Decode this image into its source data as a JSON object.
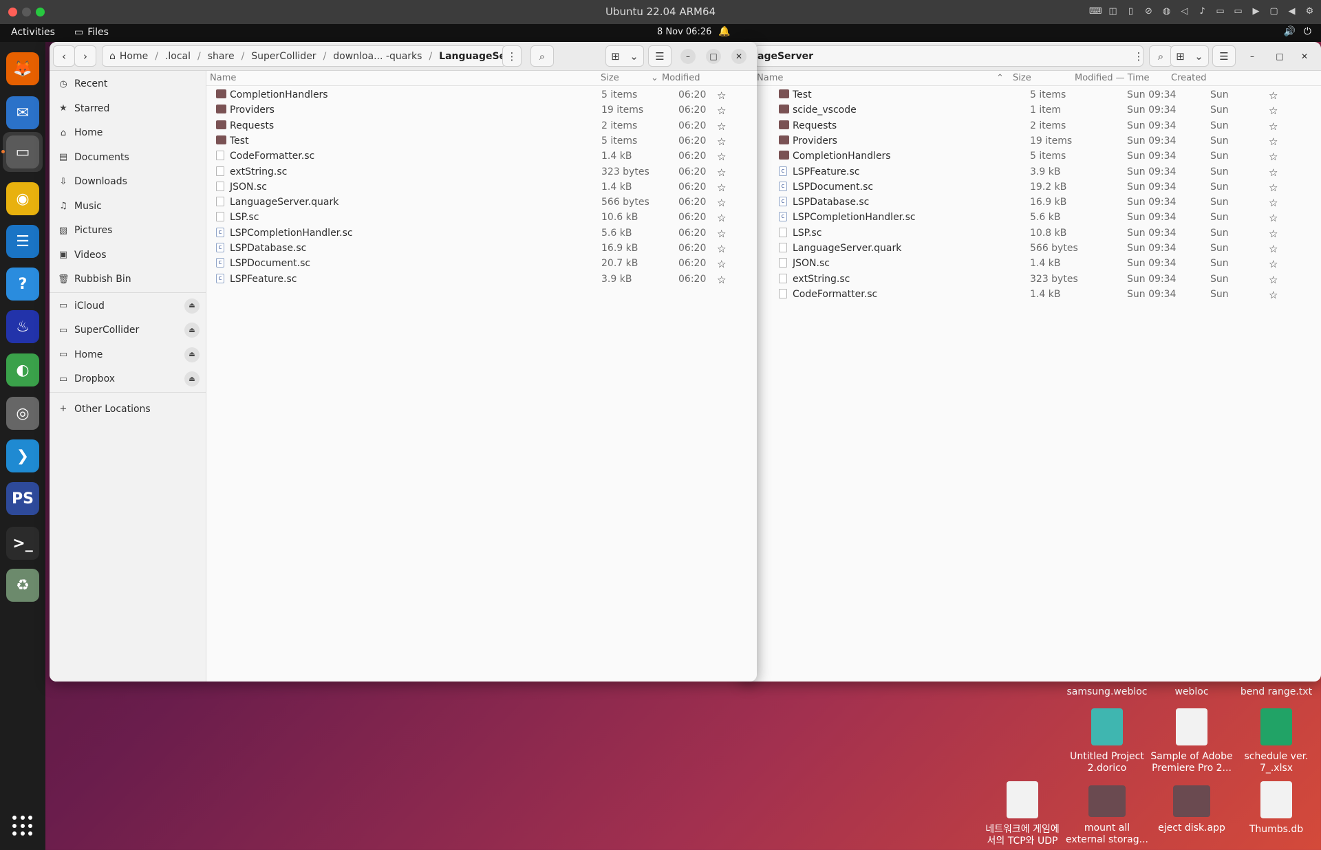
{
  "mac": {
    "title": "Ubuntu 22.04 ARM64",
    "traffic_colors": [
      "#ff5f57",
      "#5a5a5a",
      "#28c840"
    ],
    "status_icons": [
      "keyboard-icon",
      "screenshot-icon",
      "usb-icon",
      "camera-off-icon",
      "globe-icon",
      "speaker-icon",
      "mic-icon",
      "disk-icon",
      "disk2-icon",
      "camera-icon",
      "display-icon",
      "back-icon",
      "gear-icon"
    ]
  },
  "topbar": {
    "activities": "Activities",
    "app_name": "Files",
    "clock": "8 Nov  06:26"
  },
  "dock": {
    "apps": [
      {
        "name": "firefox",
        "glyph": "🦊",
        "color": "#e66000"
      },
      {
        "name": "thunderbird",
        "glyph": "✉",
        "color": "#2b72c9"
      },
      {
        "name": "files",
        "glyph": "▭",
        "color": "#5a5a5a"
      },
      {
        "name": "rhythmbox",
        "glyph": "◉",
        "color": "#e8b10e"
      },
      {
        "name": "writer",
        "glyph": "☰",
        "color": "#1a74c5"
      },
      {
        "name": "help",
        "glyph": "?",
        "color": "#2a8cde"
      },
      {
        "name": "supercollider",
        "glyph": "♨",
        "color": "#2233aa"
      },
      {
        "name": "app-green",
        "glyph": "◐",
        "color": "#3aa14a"
      },
      {
        "name": "app-swirl",
        "glyph": "◎",
        "color": "#666"
      },
      {
        "name": "vscode",
        "glyph": "❯",
        "color": "#1f8ad2"
      },
      {
        "name": "ps",
        "glyph": "PS",
        "color": "#2e4a9a"
      },
      {
        "name": "terminal",
        "glyph": ">_",
        "color": "#2b2b2b"
      },
      {
        "name": "trash",
        "glyph": "♻",
        "color": "#6c8a6c"
      }
    ]
  },
  "left": {
    "path": [
      "Home",
      ".local",
      "share",
      "SuperCollider",
      "downloa... -quarks",
      "LanguageServer"
    ],
    "sidebar": [
      {
        "label": "Recent",
        "icon": "clock-icon",
        "glyph": "◷"
      },
      {
        "label": "Starred",
        "icon": "star-icon",
        "glyph": "★"
      },
      {
        "label": "Home",
        "icon": "home-icon",
        "glyph": "⌂"
      },
      {
        "label": "Documents",
        "icon": "document-icon",
        "glyph": "▤"
      },
      {
        "label": "Downloads",
        "icon": "download-icon",
        "glyph": "⇩"
      },
      {
        "label": "Music",
        "icon": "music-icon",
        "glyph": "♫"
      },
      {
        "label": "Pictures",
        "icon": "picture-icon",
        "glyph": "▨"
      },
      {
        "label": "Videos",
        "icon": "video-icon",
        "glyph": "▣"
      },
      {
        "label": "Rubbish Bin",
        "icon": "trash-icon",
        "glyph": "🗑"
      }
    ],
    "drives": [
      {
        "label": "iCloud"
      },
      {
        "label": "SuperCollider"
      },
      {
        "label": "Home"
      },
      {
        "label": "Dropbox"
      }
    ],
    "other": "Other Locations",
    "columns": {
      "name": "Name",
      "size": "Size",
      "modified": "Modified"
    },
    "rows": [
      {
        "name": "CompletionHandlers",
        "type": "folder",
        "size": "5 items",
        "modified": "06:20"
      },
      {
        "name": "Providers",
        "type": "folder",
        "size": "19 items",
        "modified": "06:20"
      },
      {
        "name": "Requests",
        "type": "folder",
        "size": "2 items",
        "modified": "06:20"
      },
      {
        "name": "Test",
        "type": "folder",
        "size": "5 items",
        "modified": "06:20"
      },
      {
        "name": "CodeFormatter.sc",
        "type": "file",
        "size": "1.4 kB",
        "modified": "06:20"
      },
      {
        "name": "extString.sc",
        "type": "file",
        "size": "323 bytes",
        "modified": "06:20"
      },
      {
        "name": "JSON.sc",
        "type": "file",
        "size": "1.4 kB",
        "modified": "06:20"
      },
      {
        "name": "LanguageServer.quark",
        "type": "file",
        "size": "566 bytes",
        "modified": "06:20"
      },
      {
        "name": "LSP.sc",
        "type": "file",
        "size": "10.6 kB",
        "modified": "06:20"
      },
      {
        "name": "LSPCompletionHandler.sc",
        "type": "cfile",
        "size": "5.6 kB",
        "modified": "06:20"
      },
      {
        "name": "LSPDatabase.sc",
        "type": "cfile",
        "size": "16.9 kB",
        "modified": "06:20"
      },
      {
        "name": "LSPDocument.sc",
        "type": "cfile",
        "size": "20.7 kB",
        "modified": "06:20"
      },
      {
        "name": "LSPFeature.sc",
        "type": "cfile",
        "size": "3.9 kB",
        "modified": "06:20"
      }
    ]
  },
  "right": {
    "path_fragment": "ageServer",
    "columns": {
      "name": "Name",
      "size": "Size",
      "modified": "Modified — Time",
      "created": "Created"
    },
    "rows": [
      {
        "name": "Test",
        "type": "folder",
        "size": "5 items",
        "modified": "Sun 09:34",
        "created": "Sun"
      },
      {
        "name": "scide_vscode",
        "type": "folder",
        "size": "1 item",
        "modified": "Sun 09:34",
        "created": "Sun"
      },
      {
        "name": "Requests",
        "type": "folder",
        "size": "2 items",
        "modified": "Sun 09:34",
        "created": "Sun"
      },
      {
        "name": "Providers",
        "type": "folder",
        "size": "19 items",
        "modified": "Sun 09:34",
        "created": "Sun"
      },
      {
        "name": "CompletionHandlers",
        "type": "folder",
        "size": "5 items",
        "modified": "Sun 09:34",
        "created": "Sun"
      },
      {
        "name": "LSPFeature.sc",
        "type": "cfile",
        "size": "3.9 kB",
        "modified": "Sun 09:34",
        "created": "Sun"
      },
      {
        "name": "LSPDocument.sc",
        "type": "cfile",
        "size": "19.2 kB",
        "modified": "Sun 09:34",
        "created": "Sun"
      },
      {
        "name": "LSPDatabase.sc",
        "type": "cfile",
        "size": "16.9 kB",
        "modified": "Sun 09:34",
        "created": "Sun"
      },
      {
        "name": "LSPCompletionHandler.sc",
        "type": "cfile",
        "size": "5.6 kB",
        "modified": "Sun 09:34",
        "created": "Sun"
      },
      {
        "name": "LSP.sc",
        "type": "file",
        "size": "10.8 kB",
        "modified": "Sun 09:34",
        "created": "Sun"
      },
      {
        "name": "LanguageServer.quark",
        "type": "file",
        "size": "566 bytes",
        "modified": "Sun 09:34",
        "created": "Sun"
      },
      {
        "name": "JSON.sc",
        "type": "file",
        "size": "1.4 kB",
        "modified": "Sun 09:34",
        "created": "Sun"
      },
      {
        "name": "extString.sc",
        "type": "file",
        "size": "323 bytes",
        "modified": "Sun 09:34",
        "created": "Sun"
      },
      {
        "name": "CodeFormatter.sc",
        "type": "file",
        "size": "1.4 kB",
        "modified": "Sun 09:34",
        "created": "Sun"
      }
    ]
  },
  "desktop": {
    "cutoff": [
      {
        "label": "samsung.webloc"
      },
      {
        "label": "webloc"
      },
      {
        "label": "bend range.txt"
      }
    ],
    "icons": [
      {
        "label": "Untitled Project 2.dorico",
        "kind": "zip",
        "color": "#3fb6b0"
      },
      {
        "label": "Sample of Adobe Premiere Pro 2...",
        "kind": "doc",
        "color": "#f2f2f2"
      },
      {
        "label": "schedule ver. 7_.xlsx",
        "kind": "xlsx",
        "color": "#21a366"
      },
      {
        "label": "네트워크에 게임에 서의 TCP와 UDP ...",
        "kind": "binary",
        "color": "#f2f2f2"
      },
      {
        "label": "mount all external storag...",
        "kind": "folder",
        "color": "#6a4a50"
      },
      {
        "label": "eject disk.app",
        "kind": "folder",
        "color": "#6a4a50"
      },
      {
        "label": "Thumbs.db",
        "kind": "doc",
        "color": "#f2f2f2"
      }
    ]
  }
}
